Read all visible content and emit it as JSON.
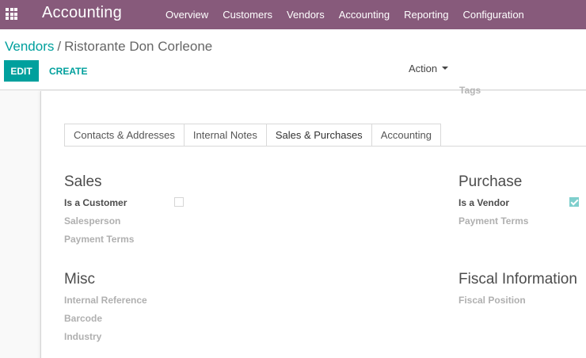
{
  "navbar": {
    "brand": "Accounting",
    "menu": [
      "Overview",
      "Customers",
      "Vendors",
      "Accounting",
      "Reporting",
      "Configuration"
    ]
  },
  "breadcrumb": {
    "parent": "Vendors",
    "separator": "/",
    "current": "Ristorante Don Corleone"
  },
  "buttons": {
    "edit": "EDIT",
    "create": "CREATE",
    "action": "Action"
  },
  "form": {
    "tags_label": "Tags",
    "tabs": [
      "Contacts & Addresses",
      "Internal Notes",
      "Sales & Purchases",
      "Accounting"
    ],
    "active_tab": "Sales & Purchases",
    "sales": {
      "title": "Sales",
      "is_customer_label": "Is a Customer",
      "is_customer": false,
      "salesperson_label": "Salesperson",
      "payment_terms_label": "Payment Terms"
    },
    "purchase": {
      "title": "Purchase",
      "is_vendor_label": "Is a Vendor",
      "is_vendor": true,
      "payment_terms_label": "Payment Terms"
    },
    "misc": {
      "title": "Misc",
      "internal_reference_label": "Internal Reference",
      "barcode_label": "Barcode",
      "industry_label": "Industry"
    },
    "fiscal": {
      "title": "Fiscal Information",
      "fiscal_position_label": "Fiscal Position"
    }
  },
  "colors": {
    "navbar": "#875a7b",
    "primary": "#00a09d",
    "checkbox_checked": "#7fcfcd"
  }
}
